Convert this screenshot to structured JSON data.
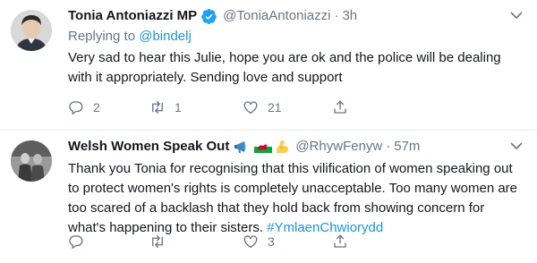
{
  "tweets": [
    {
      "name": "Tonia Antoniazzi MP",
      "handle": "@ToniaAntoniazzi",
      "time": "3h",
      "reply_prefix": "Replying to ",
      "reply_to": "@bindelj",
      "text": "Very sad to hear this Julie, hope you are ok and the police will be dealing with it appropriately. Sending love and support",
      "replies": "2",
      "retweets": "1",
      "likes": "21"
    },
    {
      "name": "Welsh Women Speak Out",
      "emojis": [
        "megaphone-icon",
        "welsh-flag-icon",
        "flexed-biceps-icon"
      ],
      "handle": "@RhywFenyw",
      "time": "57m",
      "text": "Thank you Tonia for recognising that this vilification of women speaking out to protect women's rights is completely unacceptable. Too many women are too scared of a backlash that they hold back from showing concern for what's happening to their sisters. ",
      "hashtag": "#YmlaenChwiorydd",
      "replies": "",
      "retweets": "",
      "likes": "3"
    }
  ],
  "colors": {
    "link": "#1b95e0",
    "secondary": "#657786",
    "text": "#14171a",
    "verified": "#1da1f2",
    "divider": "#e6ecf0"
  }
}
